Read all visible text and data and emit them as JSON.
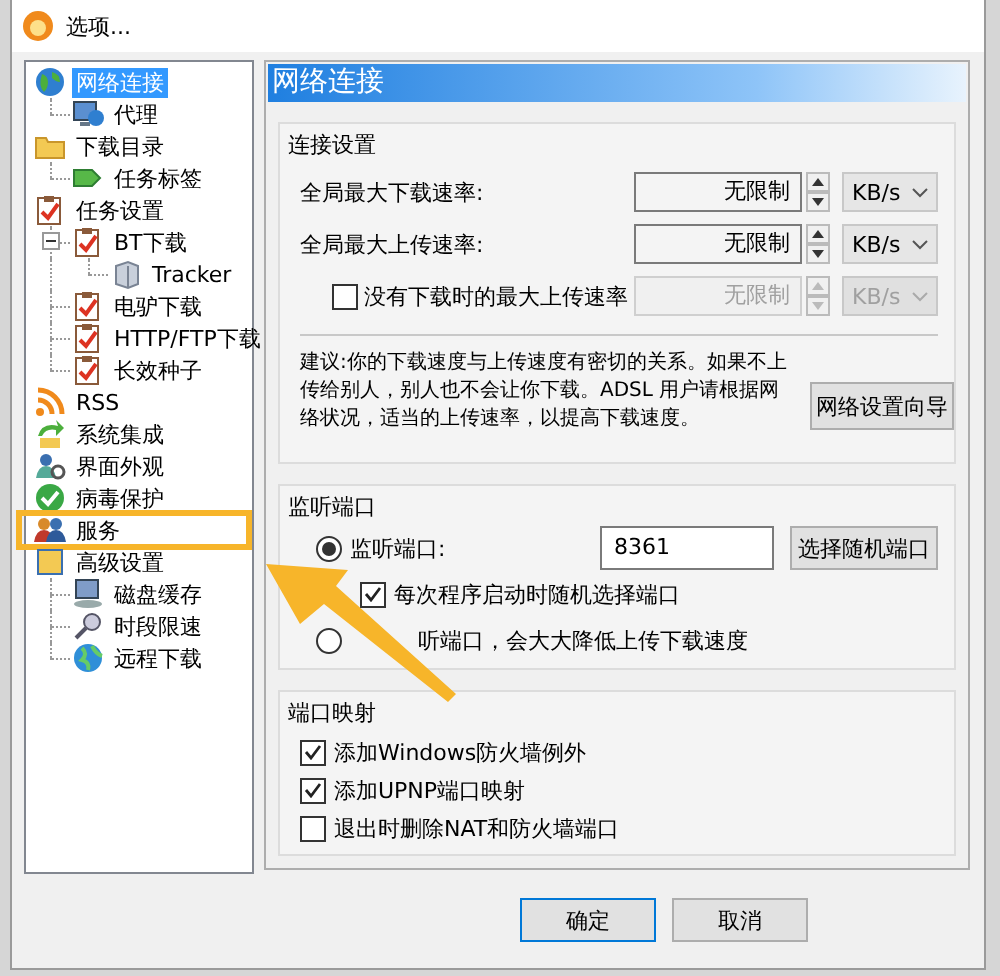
{
  "window": {
    "title": "选项..."
  },
  "sidebar": {
    "items": [
      {
        "label": "网络连接",
        "selected": true,
        "highlighted": false,
        "children": [
          {
            "label": "代理",
            "selected": false
          }
        ]
      },
      {
        "label": "下载目录",
        "selected": false,
        "highlighted": false,
        "children": [
          {
            "label": "任务标签",
            "selected": false
          }
        ]
      },
      {
        "label": "任务设置",
        "selected": false,
        "highlighted": false,
        "children": [
          {
            "label": "BT下载",
            "selected": false,
            "expanded": true,
            "children": [
              {
                "label": "Tracker",
                "selected": false
              }
            ]
          },
          {
            "label": "电驴下载",
            "selected": false
          },
          {
            "label": "HTTP/FTP下载",
            "selected": false
          },
          {
            "label": "长效种子",
            "selected": false
          }
        ]
      },
      {
        "label": "RSS",
        "selected": false,
        "highlighted": false
      },
      {
        "label": "系统集成",
        "selected": false,
        "highlighted": false
      },
      {
        "label": "界面外观",
        "selected": false,
        "highlighted": false
      },
      {
        "label": "病毒保护",
        "selected": false,
        "highlighted": false
      },
      {
        "label": "服务",
        "selected": false,
        "highlighted": true
      },
      {
        "label": "高级设置",
        "selected": false,
        "highlighted": false,
        "children": [
          {
            "label": "磁盘缓存",
            "selected": false
          },
          {
            "label": "时段限速",
            "selected": false
          },
          {
            "label": "远程下载",
            "selected": false
          }
        ]
      }
    ]
  },
  "panel": {
    "title": "网络连接"
  },
  "connection": {
    "title": "连接设置",
    "rates": [
      {
        "kind": "label",
        "label": "全局最大下载速率:",
        "value": "无限制",
        "unit": "KB/s",
        "disabled": false
      },
      {
        "kind": "label",
        "label": "全局最大上传速率:",
        "value": "无限制",
        "unit": "KB/s",
        "disabled": false
      },
      {
        "kind": "checkbox",
        "label": "没有下载时的最大上传速率",
        "checked": false,
        "value": "无限制",
        "unit": "KB/s",
        "disabled": true
      }
    ],
    "advice": "建议:你的下载速度与上传速度有密切的关系。如果不上传给别人，别人也不会让你下载。ADSL 用户请根据网络状况，适当的上传速率，以提高下载速度。",
    "wizard_button": "网络设置向导"
  },
  "listen": {
    "title": "监听端口",
    "options": [
      {
        "kind": "radio",
        "label": "监听端口:",
        "selected": true,
        "port": "8361",
        "button": "选择随机端口"
      },
      {
        "kind": "checkbox",
        "label": "每次程序启动时随机选择端口",
        "checked": true
      },
      {
        "kind": "radio",
        "label": "听端口，会大大降低上传下载速度",
        "selected": false
      }
    ]
  },
  "mapping": {
    "title": "端口映射",
    "options": [
      {
        "label": "添加Windows防火墙例外",
        "checked": true
      },
      {
        "label": "添加UPNP端口映射",
        "checked": true
      },
      {
        "label": "退出时删除NAT和防火墙端口",
        "checked": false
      }
    ]
  },
  "buttons": [
    {
      "label": "确定",
      "default": true
    },
    {
      "label": "取消",
      "default": false
    }
  ]
}
